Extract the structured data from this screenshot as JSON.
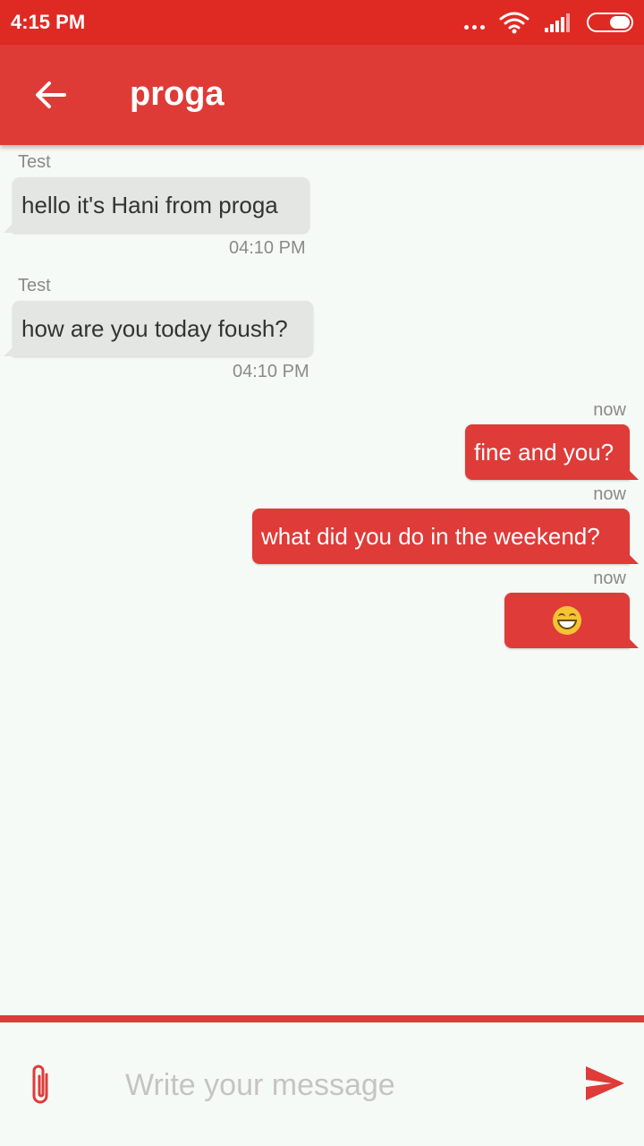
{
  "status_bar": {
    "time": "4:15 PM"
  },
  "header": {
    "title": "proga",
    "back_icon": "arrow-left-icon"
  },
  "messages": [
    {
      "direction": "in",
      "sender": "Test",
      "text": "hello it's Hani from proga",
      "time": "04:10 PM"
    },
    {
      "direction": "in",
      "sender": "Test",
      "text": "how are you today foush?",
      "time": "04:10 PM"
    },
    {
      "direction": "out",
      "text": "fine and you?",
      "time": "now"
    },
    {
      "direction": "out",
      "text": "what did you do in the weekend?",
      "time": "now"
    },
    {
      "direction": "out",
      "emoji": "grinning-face-icon",
      "time": "now"
    }
  ],
  "composer": {
    "placeholder": "Write your message",
    "value": "",
    "attach_icon": "paperclip-icon",
    "send_icon": "send-icon"
  },
  "colors": {
    "status_bar": "#df2a24",
    "app_bar": "#de3b37",
    "accent": "#df3b38",
    "incoming_bubble": "#e3e6e3",
    "background": "#f6faf6"
  }
}
